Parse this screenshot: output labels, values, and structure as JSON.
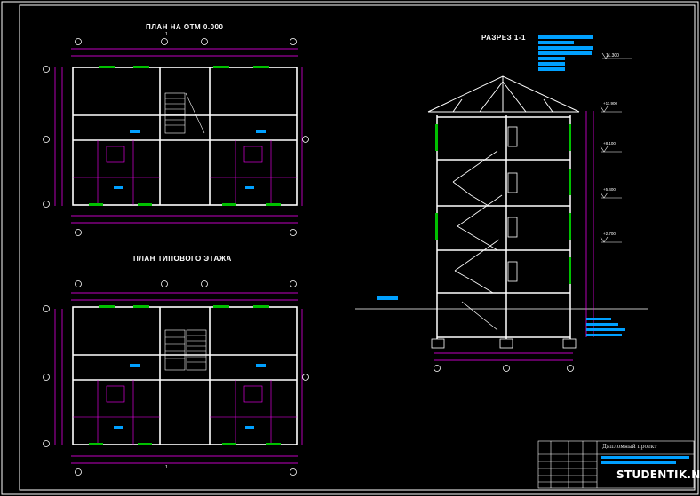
{
  "drawing": {
    "plan_ground_title": "ПЛАН НА ОТМ 0.000",
    "plan_typical_title": "ПЛАН ТИПОВОГО ЭТАЖА",
    "section_title": "РАЗРЕЗ 1-1",
    "section_marker": "1",
    "section_marks": [
      "+11.900",
      "+8.100",
      "+5.400",
      "+2.700"
    ],
    "ridge_mark": "11.300"
  },
  "title_block": {
    "project_title": "Дипломный проект"
  },
  "watermark": "STUDENTIK.NET",
  "colors": {
    "background": "#000000",
    "frame": "#ffffff",
    "dimensions": "#ff00ff",
    "windows": "#00c000",
    "labels": "#00a0ff"
  }
}
